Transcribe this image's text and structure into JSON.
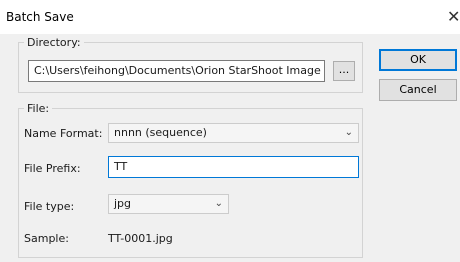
{
  "window": {
    "title": "Batch Save",
    "close_glyph": "✕"
  },
  "directory": {
    "label": "Directory:",
    "path": "C:\\Users\\feihong\\Documents\\Orion StarShoot Image Captu",
    "browse_label": "..."
  },
  "file": {
    "group_label": "File:",
    "name_format_label": "Name Format:",
    "name_format_value": "nnnn (sequence)",
    "prefix_label": "File Prefix:",
    "prefix_value": "TT",
    "type_label": "File type:",
    "type_value": "jpg",
    "sample_label": "Sample:",
    "sample_value": "TT-0001.jpg"
  },
  "buttons": {
    "ok": "OK",
    "cancel": "Cancel"
  },
  "icons": {
    "close": "close-icon",
    "dropdown": "chevron-down-icon"
  },
  "colors": {
    "focus_border": "#0078d7",
    "dialog_background": "#f0f0f0"
  }
}
